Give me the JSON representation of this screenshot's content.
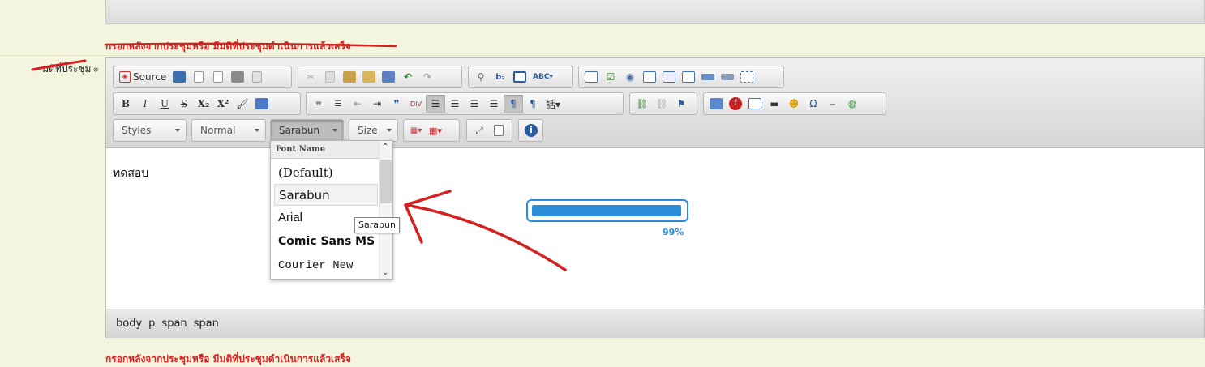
{
  "page": {
    "instruction_text": "กรอกหลังจากประชุมหรือ มีมติที่ประชุมดำเนินการแล้วเสร็จ",
    "field_label": "มติที่ประชุม",
    "required_mark": "※"
  },
  "toolbar": {
    "source_label": "Source",
    "styles_label": "Styles",
    "format_label": "Normal",
    "font_label": "Sarabun",
    "size_label": "Size"
  },
  "content": {
    "text": "ทดสอบ"
  },
  "font_dropdown": {
    "header": "Font Name",
    "items": [
      "(Default)",
      "Sarabun",
      "Arial",
      "Comic Sans MS",
      "Courier New"
    ],
    "selected": "Sarabun"
  },
  "tooltip": {
    "text": "Sarabun"
  },
  "progress": {
    "value": 0.99,
    "label": "99%",
    "color": "#2a8fd8"
  },
  "status_bar": {
    "path": [
      "body",
      "p",
      "span",
      "span"
    ]
  },
  "colors": {
    "instruction": "#d82020",
    "annotation": "#d42020"
  }
}
